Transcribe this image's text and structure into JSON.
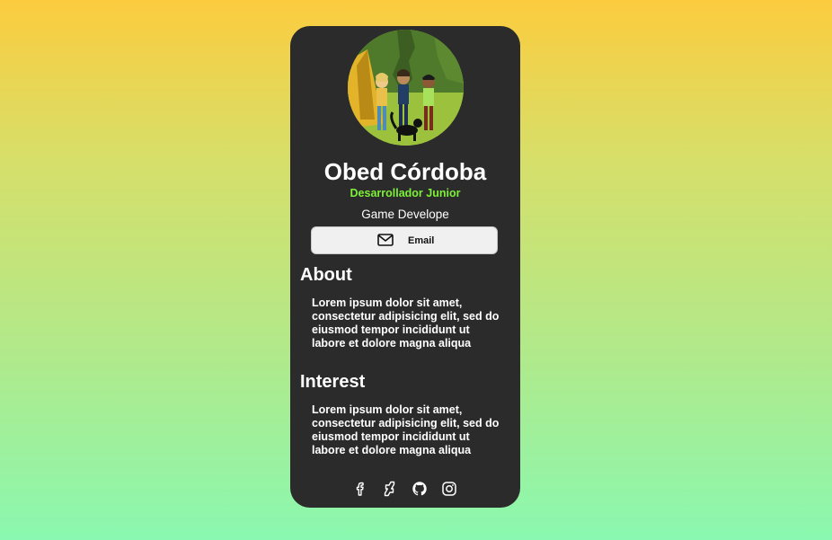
{
  "profile": {
    "name": "Obed Córdoba",
    "role": "Desarrollador Junior",
    "subtitle": "Game Develope",
    "avatar_icon": "profile-illustration",
    "accent_color": "#7cf135"
  },
  "actions": {
    "email_label": "Email",
    "email_icon": "mail-icon"
  },
  "about": {
    "title": "About",
    "text": "Lorem ipsum dolor sit amet, consectetur adipisicing elit, sed do eiusmod tempor incididunt ut labore et dolore magna aliqua"
  },
  "interest": {
    "title": "Interest",
    "text": "Lorem ipsum dolor sit amet, consectetur adipisicing elit, sed do eiusmod tempor incididunt ut labore et dolore magna aliqua"
  },
  "social": [
    {
      "icon": "facebook-icon"
    },
    {
      "icon": "deviantart-icon"
    },
    {
      "icon": "github-icon"
    },
    {
      "icon": "instagram-icon"
    }
  ],
  "colors": {
    "card_background": "#2b2b2b",
    "background_top": "#fccc3e",
    "background_bottom": "#8af8b0"
  }
}
